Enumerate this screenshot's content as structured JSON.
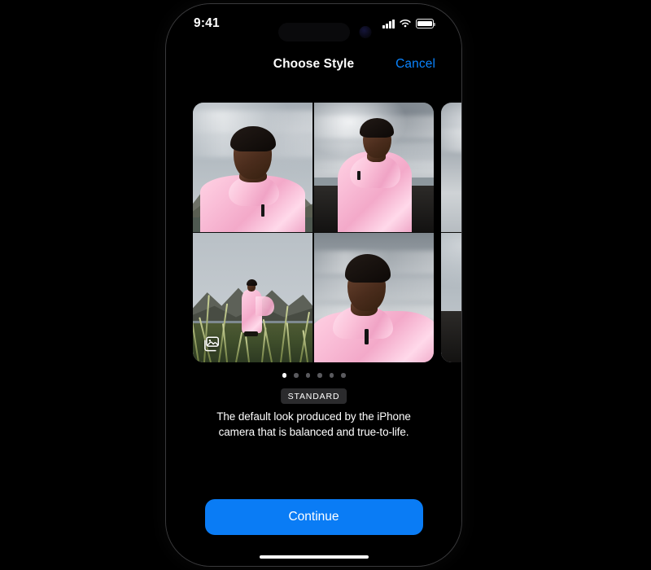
{
  "device": {
    "status_bar": {
      "time": "9:41",
      "cellular_icon": "cellular-bars-icon",
      "wifi_icon": "wifi-icon",
      "battery_icon": "battery-full-icon",
      "battery_level_pct": 100
    },
    "home_indicator": "home-indicator"
  },
  "nav": {
    "title": "Choose Style",
    "cancel_label": "Cancel",
    "cancel_color": "#0a84ff"
  },
  "carousel": {
    "current_index": 0,
    "total": 6,
    "stack_icon": "photo-stack-icon",
    "cards": [
      {
        "style": "STANDARD",
        "photos": [
          {
            "alt": "Man in pink jacket smiling, mountains behind",
            "scene": "mountain-selfie"
          },
          {
            "alt": "Man in pink jacket on black sand beach",
            "scene": "beach"
          },
          {
            "alt": "Man in pink outfit standing in tall grass, mountains",
            "scene": "grass"
          },
          {
            "alt": "Close-up portrait of man in pink collar, cloudy sky",
            "scene": "portrait"
          }
        ]
      }
    ]
  },
  "style_info": {
    "badge": "STANDARD",
    "description": "The default look produced by the iPhone camera that is balanced and true-to-life."
  },
  "footer": {
    "continue_label": "Continue",
    "continue_color": "#0a7cf5"
  }
}
